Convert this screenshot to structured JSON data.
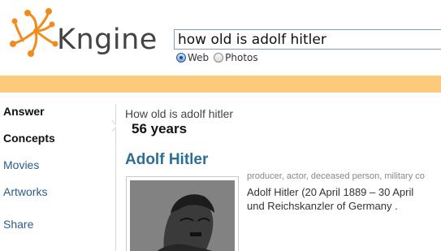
{
  "logo": {
    "text": "Kngine"
  },
  "search": {
    "query": "how old is adolf hitler"
  },
  "search_options": [
    {
      "label": "Web",
      "selected": true
    },
    {
      "label": "Photos",
      "selected": false
    }
  ],
  "colors": {
    "accent_bar": "#fdc97a",
    "link": "#2d5d8a",
    "title": "#2d6e96",
    "logo_orange": "#f28a1c"
  },
  "sidebar": {
    "items": [
      {
        "label": "Answer",
        "style": "bold"
      },
      {
        "label": "Concepts",
        "style": "bold"
      },
      {
        "label": "Movies",
        "style": "link"
      },
      {
        "label": "Artworks",
        "style": "link"
      },
      {
        "label": "Share",
        "style": "link"
      }
    ]
  },
  "main": {
    "query_echo": "How old is adolf hitler",
    "answer": "56 years",
    "entity": {
      "title": "Adolf Hitler",
      "tags": "producer, actor, deceased person, military co",
      "description_line1": "Adolf Hitler (20 April 1889 – 30 April",
      "description_line2": "und Reichskanzler of Germany ."
    }
  }
}
